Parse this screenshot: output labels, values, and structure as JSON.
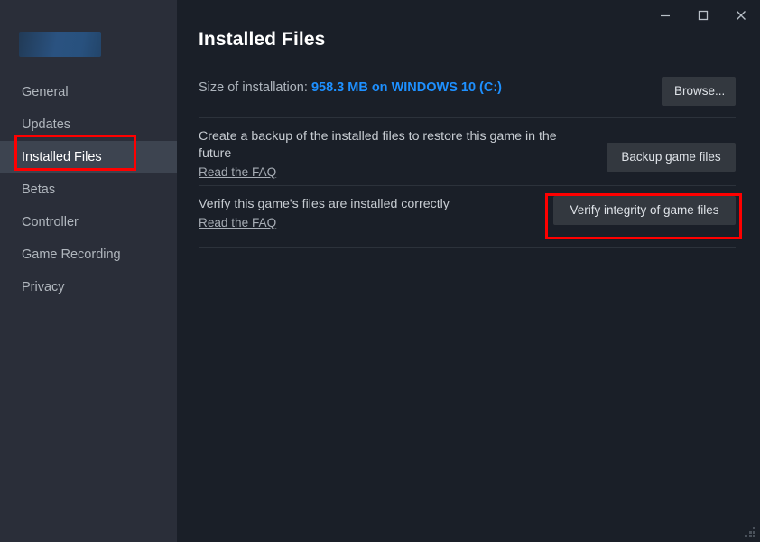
{
  "window": {
    "controls": [
      {
        "name": "minimize-button",
        "icon": "minimize-icon"
      },
      {
        "name": "maximize-button",
        "icon": "maximize-icon"
      },
      {
        "name": "close-button",
        "icon": "close-icon"
      }
    ],
    "resize_grip": "resize-grip"
  },
  "sidebar": {
    "banner": "game-header-image",
    "items": [
      {
        "label": "General",
        "selected": false
      },
      {
        "label": "Updates",
        "selected": false
      },
      {
        "label": "Installed Files",
        "selected": true
      },
      {
        "label": "Betas",
        "selected": false
      },
      {
        "label": "Controller",
        "selected": false
      },
      {
        "label": "Game Recording",
        "selected": false
      },
      {
        "label": "Privacy",
        "selected": false
      }
    ]
  },
  "main": {
    "title": "Installed Files",
    "size_row": {
      "label": "Size of installation: ",
      "value": "958.3 MB on WINDOWS 10 (C:)",
      "browse_label": "Browse..."
    },
    "backup_row": {
      "description": "Create a backup of the installed files to restore this game in the future",
      "faq_label": "Read the FAQ",
      "button_label": "Backup game files"
    },
    "verify_row": {
      "description": "Verify this game's files are installed correctly",
      "faq_label": "Read the FAQ",
      "button_label": "Verify integrity of game files"
    }
  },
  "annotations": {
    "highlight_color": "#ff0000",
    "targets": [
      "Installed Files",
      "Verify integrity of game files"
    ]
  },
  "colors": {
    "sidebar_bg": "#2a2e39",
    "main_bg": "#1a1f28",
    "selected_bg": "#3d4450",
    "accent_link": "#1e90ff",
    "button_bg": "#33383f"
  }
}
